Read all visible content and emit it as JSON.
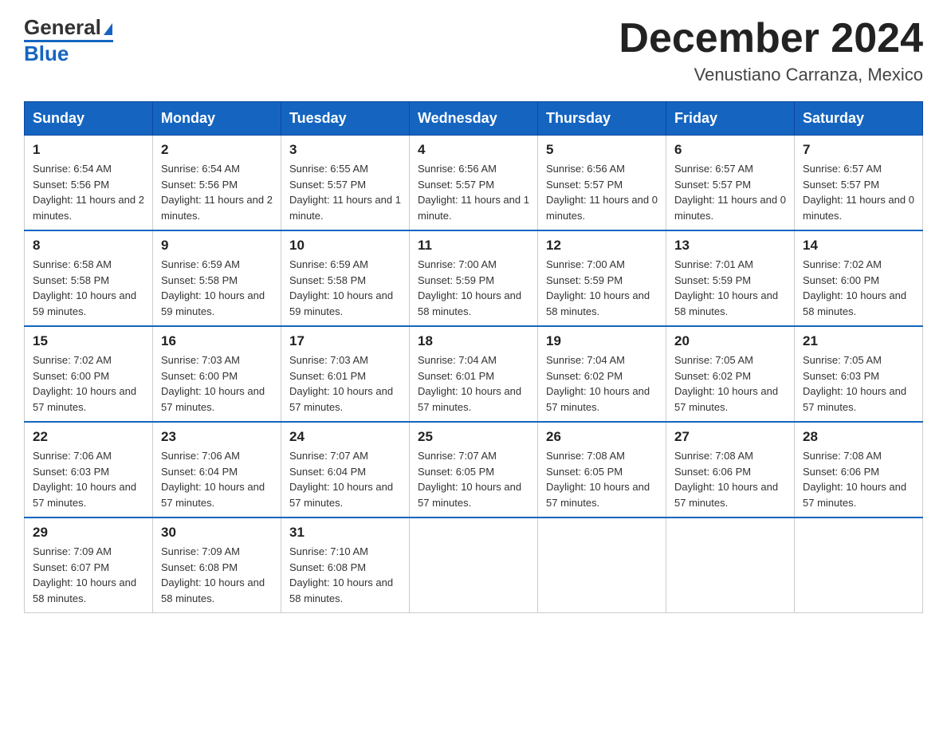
{
  "header": {
    "logo_general": "General",
    "logo_blue": "Blue",
    "title": "December 2024",
    "subtitle": "Venustiano Carranza, Mexico"
  },
  "calendar": {
    "days_of_week": [
      "Sunday",
      "Monday",
      "Tuesday",
      "Wednesday",
      "Thursday",
      "Friday",
      "Saturday"
    ],
    "weeks": [
      [
        {
          "num": "1",
          "sunrise": "6:54 AM",
          "sunset": "5:56 PM",
          "daylight": "11 hours and 2 minutes."
        },
        {
          "num": "2",
          "sunrise": "6:54 AM",
          "sunset": "5:56 PM",
          "daylight": "11 hours and 2 minutes."
        },
        {
          "num": "3",
          "sunrise": "6:55 AM",
          "sunset": "5:57 PM",
          "daylight": "11 hours and 1 minute."
        },
        {
          "num": "4",
          "sunrise": "6:56 AM",
          "sunset": "5:57 PM",
          "daylight": "11 hours and 1 minute."
        },
        {
          "num": "5",
          "sunrise": "6:56 AM",
          "sunset": "5:57 PM",
          "daylight": "11 hours and 0 minutes."
        },
        {
          "num": "6",
          "sunrise": "6:57 AM",
          "sunset": "5:57 PM",
          "daylight": "11 hours and 0 minutes."
        },
        {
          "num": "7",
          "sunrise": "6:57 AM",
          "sunset": "5:57 PM",
          "daylight": "11 hours and 0 minutes."
        }
      ],
      [
        {
          "num": "8",
          "sunrise": "6:58 AM",
          "sunset": "5:58 PM",
          "daylight": "10 hours and 59 minutes."
        },
        {
          "num": "9",
          "sunrise": "6:59 AM",
          "sunset": "5:58 PM",
          "daylight": "10 hours and 59 minutes."
        },
        {
          "num": "10",
          "sunrise": "6:59 AM",
          "sunset": "5:58 PM",
          "daylight": "10 hours and 59 minutes."
        },
        {
          "num": "11",
          "sunrise": "7:00 AM",
          "sunset": "5:59 PM",
          "daylight": "10 hours and 58 minutes."
        },
        {
          "num": "12",
          "sunrise": "7:00 AM",
          "sunset": "5:59 PM",
          "daylight": "10 hours and 58 minutes."
        },
        {
          "num": "13",
          "sunrise": "7:01 AM",
          "sunset": "5:59 PM",
          "daylight": "10 hours and 58 minutes."
        },
        {
          "num": "14",
          "sunrise": "7:02 AM",
          "sunset": "6:00 PM",
          "daylight": "10 hours and 58 minutes."
        }
      ],
      [
        {
          "num": "15",
          "sunrise": "7:02 AM",
          "sunset": "6:00 PM",
          "daylight": "10 hours and 57 minutes."
        },
        {
          "num": "16",
          "sunrise": "7:03 AM",
          "sunset": "6:00 PM",
          "daylight": "10 hours and 57 minutes."
        },
        {
          "num": "17",
          "sunrise": "7:03 AM",
          "sunset": "6:01 PM",
          "daylight": "10 hours and 57 minutes."
        },
        {
          "num": "18",
          "sunrise": "7:04 AM",
          "sunset": "6:01 PM",
          "daylight": "10 hours and 57 minutes."
        },
        {
          "num": "19",
          "sunrise": "7:04 AM",
          "sunset": "6:02 PM",
          "daylight": "10 hours and 57 minutes."
        },
        {
          "num": "20",
          "sunrise": "7:05 AM",
          "sunset": "6:02 PM",
          "daylight": "10 hours and 57 minutes."
        },
        {
          "num": "21",
          "sunrise": "7:05 AM",
          "sunset": "6:03 PM",
          "daylight": "10 hours and 57 minutes."
        }
      ],
      [
        {
          "num": "22",
          "sunrise": "7:06 AM",
          "sunset": "6:03 PM",
          "daylight": "10 hours and 57 minutes."
        },
        {
          "num": "23",
          "sunrise": "7:06 AM",
          "sunset": "6:04 PM",
          "daylight": "10 hours and 57 minutes."
        },
        {
          "num": "24",
          "sunrise": "7:07 AM",
          "sunset": "6:04 PM",
          "daylight": "10 hours and 57 minutes."
        },
        {
          "num": "25",
          "sunrise": "7:07 AM",
          "sunset": "6:05 PM",
          "daylight": "10 hours and 57 minutes."
        },
        {
          "num": "26",
          "sunrise": "7:08 AM",
          "sunset": "6:05 PM",
          "daylight": "10 hours and 57 minutes."
        },
        {
          "num": "27",
          "sunrise": "7:08 AM",
          "sunset": "6:06 PM",
          "daylight": "10 hours and 57 minutes."
        },
        {
          "num": "28",
          "sunrise": "7:08 AM",
          "sunset": "6:06 PM",
          "daylight": "10 hours and 57 minutes."
        }
      ],
      [
        {
          "num": "29",
          "sunrise": "7:09 AM",
          "sunset": "6:07 PM",
          "daylight": "10 hours and 58 minutes."
        },
        {
          "num": "30",
          "sunrise": "7:09 AM",
          "sunset": "6:08 PM",
          "daylight": "10 hours and 58 minutes."
        },
        {
          "num": "31",
          "sunrise": "7:10 AM",
          "sunset": "6:08 PM",
          "daylight": "10 hours and 58 minutes."
        },
        null,
        null,
        null,
        null
      ]
    ]
  }
}
